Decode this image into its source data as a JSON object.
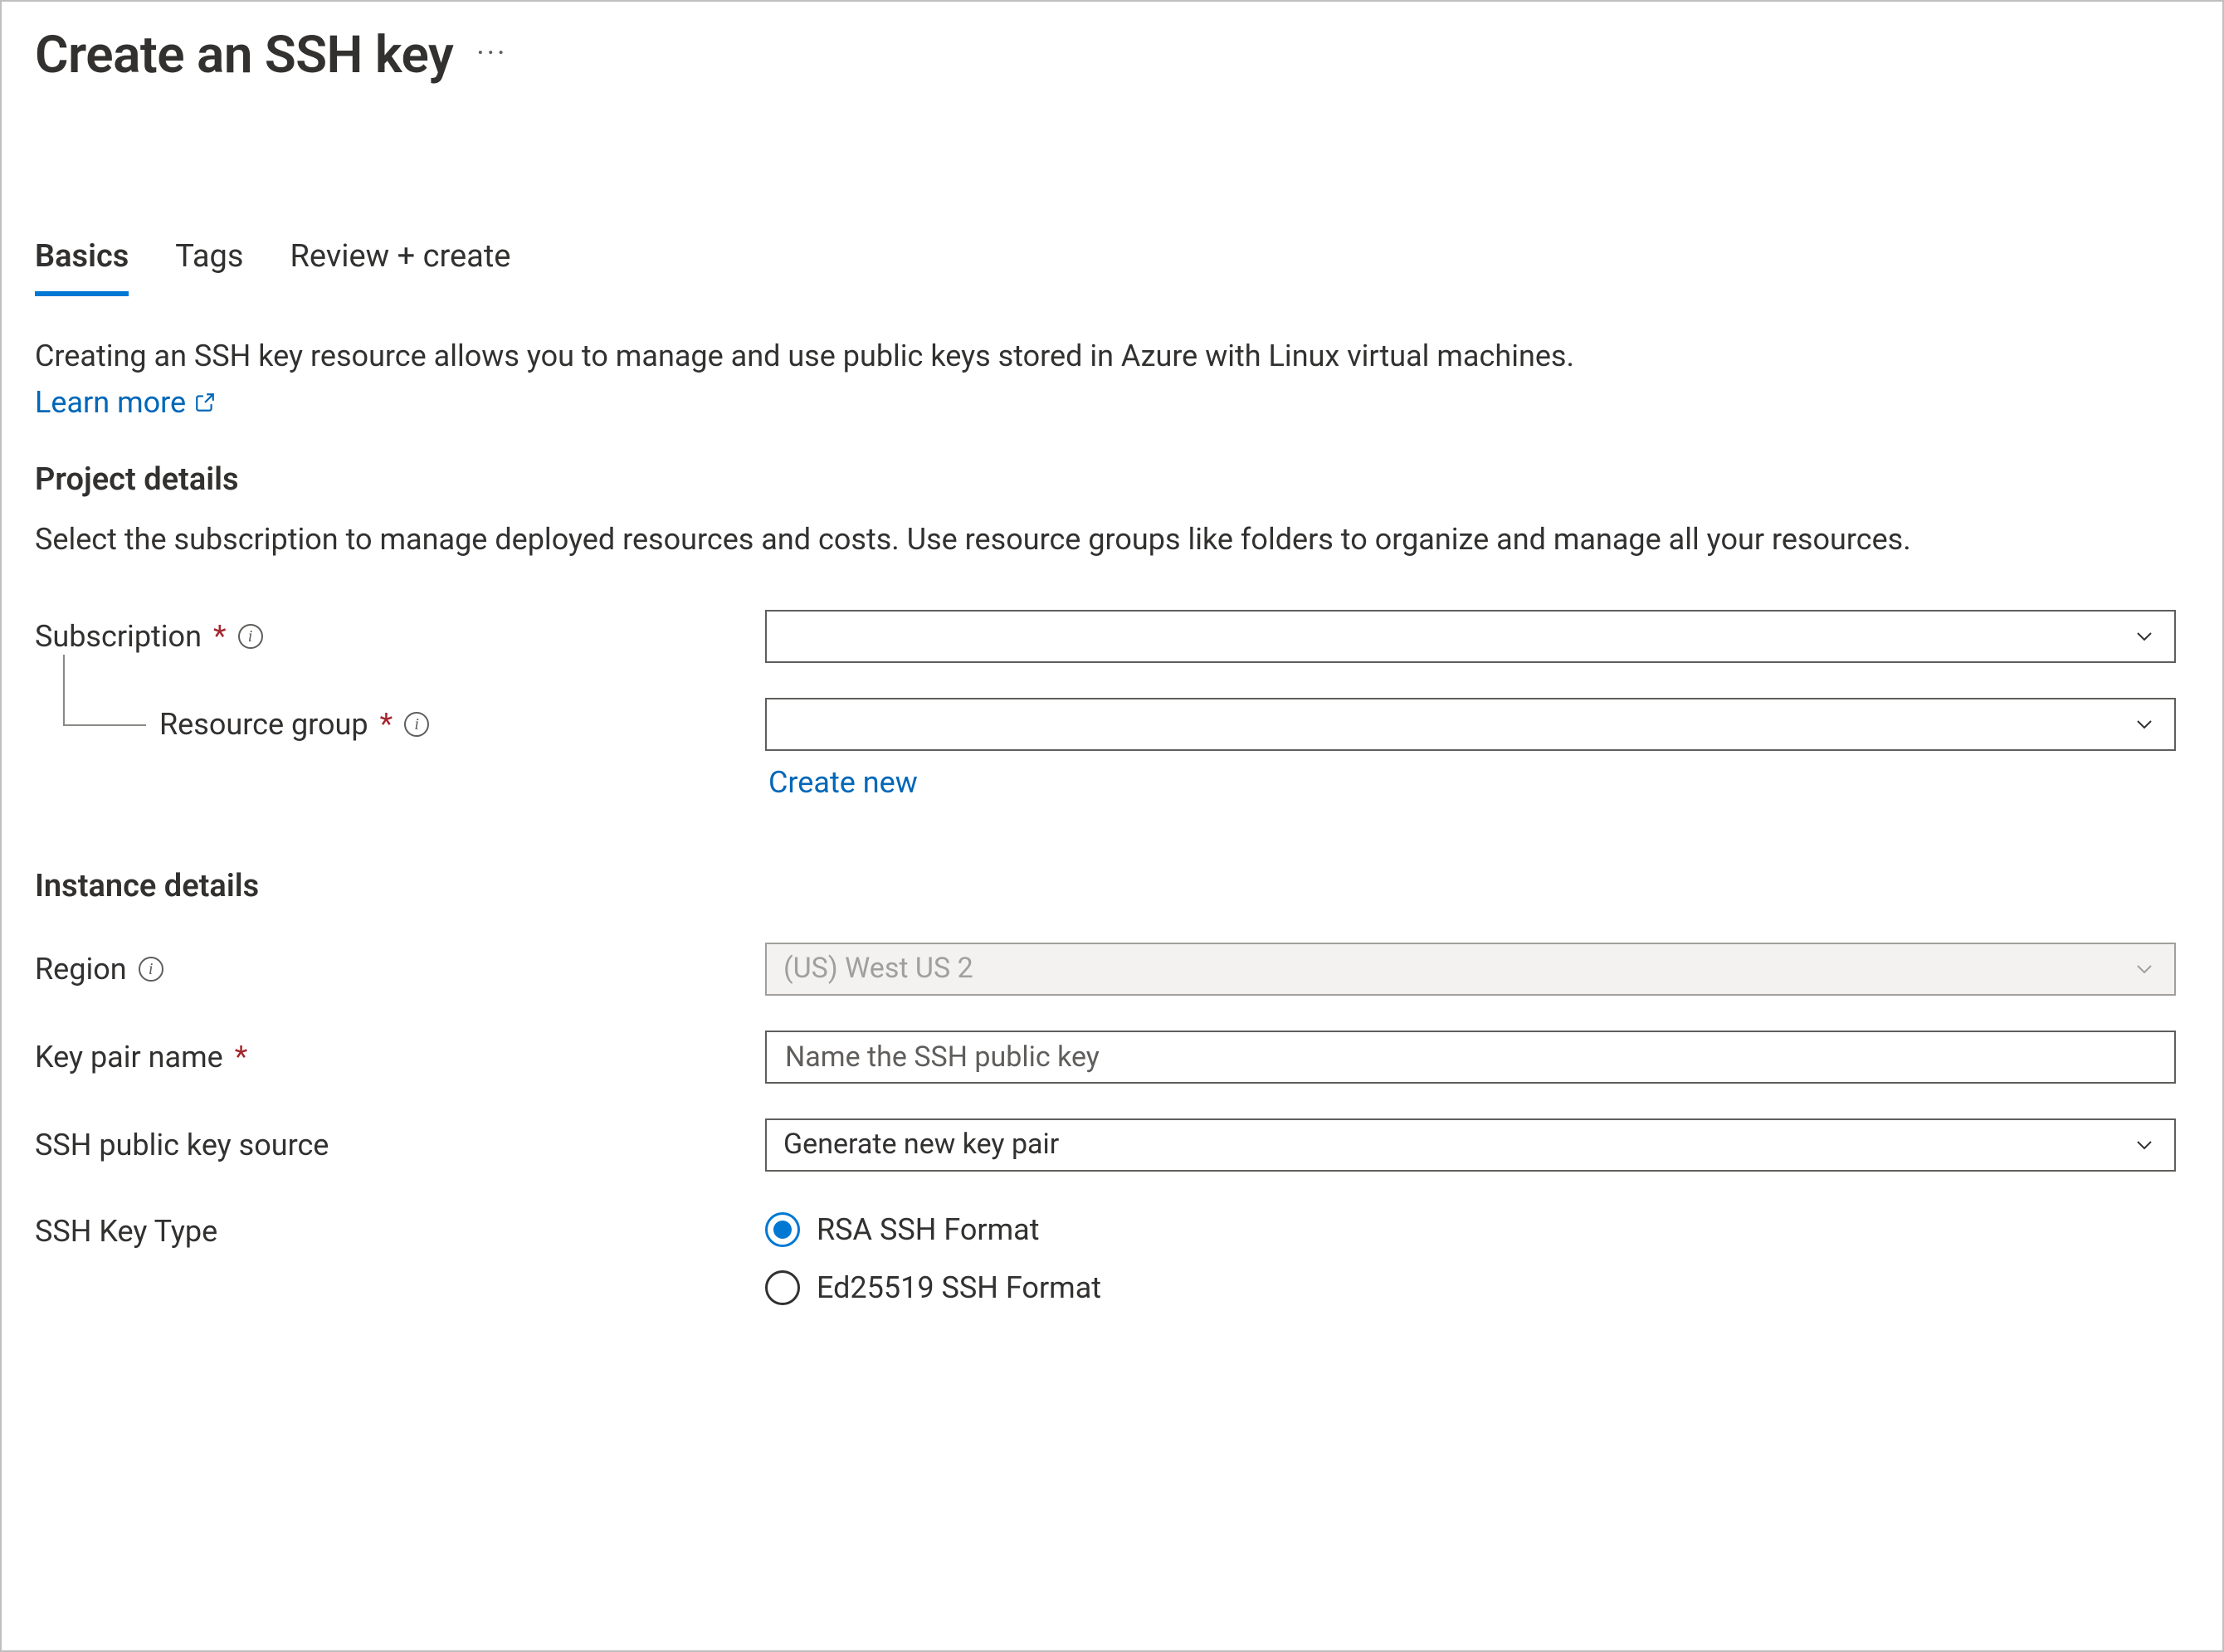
{
  "header": {
    "title": "Create an SSH key",
    "more_actions_glyph": "···"
  },
  "tabs": [
    {
      "label": "Basics",
      "active": true
    },
    {
      "label": "Tags",
      "active": false
    },
    {
      "label": "Review + create",
      "active": false
    }
  ],
  "intro": {
    "text": "Creating an SSH key resource allows you to manage and use public keys stored in Azure with Linux virtual machines.",
    "learn_more_label": "Learn more"
  },
  "project_details": {
    "heading": "Project details",
    "description": "Select the subscription to manage deployed resources and costs. Use resource groups like folders to organize and manage all your resources.",
    "subscription": {
      "label": "Subscription",
      "required": true,
      "info": true,
      "value": ""
    },
    "resource_group": {
      "label": "Resource group",
      "required": true,
      "info": true,
      "value": "",
      "create_new_label": "Create new"
    }
  },
  "instance_details": {
    "heading": "Instance details",
    "region": {
      "label": "Region",
      "required": false,
      "info": true,
      "value": "(US) West US 2",
      "disabled": true
    },
    "key_pair_name": {
      "label": "Key pair name",
      "required": true,
      "info": false,
      "value": "",
      "placeholder": "Name the SSH public key"
    },
    "ssh_key_source": {
      "label": "SSH public key source",
      "required": false,
      "info": false,
      "value": "Generate new key pair"
    },
    "ssh_key_type": {
      "label": "SSH Key Type",
      "options": [
        {
          "label": "RSA SSH Format",
          "selected": true
        },
        {
          "label": "Ed25519 SSH Format",
          "selected": false
        }
      ]
    }
  }
}
